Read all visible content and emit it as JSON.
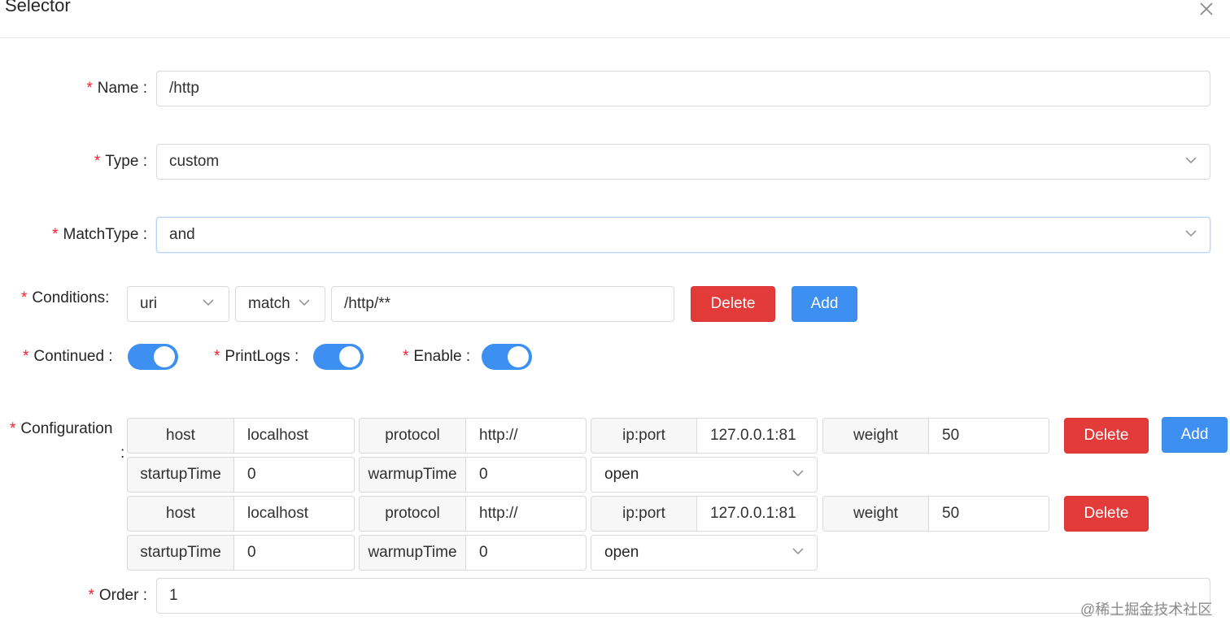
{
  "modal": {
    "title": "Selector"
  },
  "form": {
    "name": {
      "label": "Name",
      "value": "/http"
    },
    "type": {
      "label": "Type",
      "value": "custom"
    },
    "match_type": {
      "label": "MatchType",
      "value": "and"
    },
    "conditions": {
      "label": "Conditions:",
      "param_type": "uri",
      "operator": "match",
      "value": "/http/**",
      "delete_label": "Delete",
      "add_label": "Add"
    },
    "switches": {
      "continued": {
        "label": "Continued",
        "on": true
      },
      "print_logs": {
        "label": "PrintLogs",
        "on": true
      },
      "enable": {
        "label": "Enable",
        "on": true
      }
    },
    "configuration": {
      "label": "Configuration",
      "colon": ":",
      "upstreams": [
        {
          "host_label": "host",
          "host": "localhost",
          "protocol_label": "protocol",
          "protocol": "http://",
          "ip_label": "ip:port",
          "ip": "127.0.0.1:81",
          "weight_label": "weight",
          "weight": "50",
          "startup_label": "startupTime",
          "startup": "0",
          "warmup_label": "warmupTime",
          "warmup": "0",
          "status": "open",
          "delete_label": "Delete"
        },
        {
          "host_label": "host",
          "host": "localhost",
          "protocol_label": "protocol",
          "protocol": "http://",
          "ip_label": "ip:port",
          "ip": "127.0.0.1:81",
          "weight_label": "weight",
          "weight": "50",
          "startup_label": "startupTime",
          "startup": "0",
          "warmup_label": "warmupTime",
          "warmup": "0",
          "status": "open",
          "delete_label": "Delete"
        }
      ],
      "add_label": "Add"
    },
    "order": {
      "label": "Order",
      "value": "1"
    }
  },
  "watermark": "@稀土掘金技术社区",
  "colors": {
    "primary": "#3d8ff1",
    "danger": "#e33a3a",
    "required": "#f5222d"
  }
}
